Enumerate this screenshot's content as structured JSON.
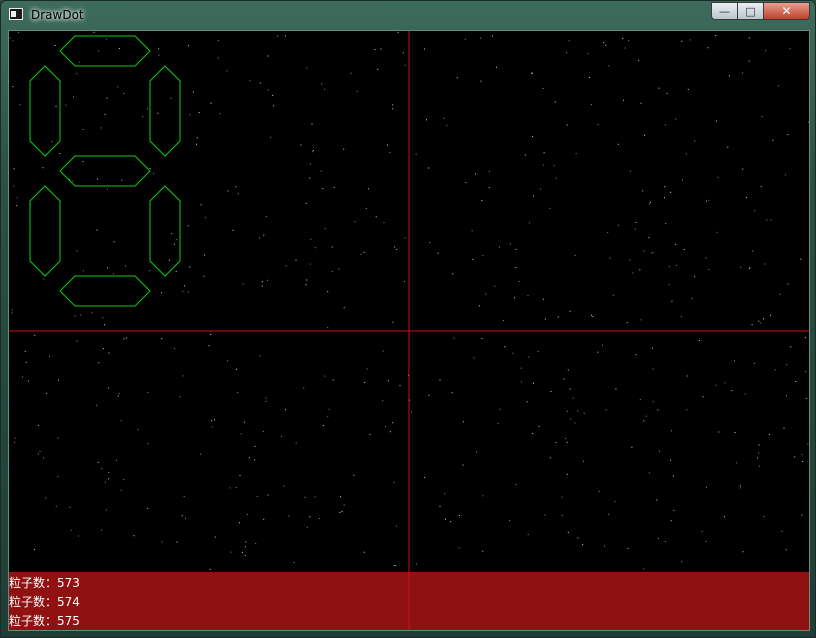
{
  "window": {
    "title": "DrawDot",
    "icon": "app-window-icon",
    "controls": {
      "minimize": "—",
      "maximize": "□",
      "close": "✕"
    }
  },
  "canvas": {
    "background": "#000000",
    "crosshair_color": "#cc1111",
    "segment_color": "#11cc11",
    "segments_lit": [
      "top",
      "upper-left",
      "upper-right",
      "middle",
      "lower-left",
      "lower-right",
      "bottom"
    ]
  },
  "status": {
    "background": "#8f1111",
    "lines": [
      "粒子数：573",
      "粒子数：574",
      "粒子数：575"
    ]
  }
}
